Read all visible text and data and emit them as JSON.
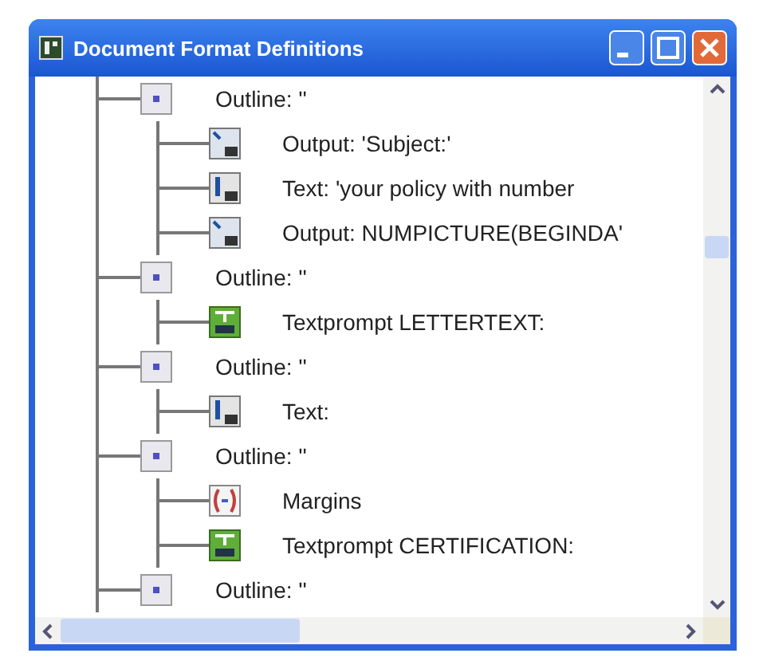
{
  "window": {
    "title": "Document Format Definitions"
  },
  "tree": [
    {
      "kind": "outline",
      "label": "Outline: ''",
      "children": [
        {
          "kind": "output",
          "label": "Output:  'Subject:'"
        },
        {
          "kind": "text",
          "label": "Text:  'your policy with number"
        },
        {
          "kind": "output",
          "label": "Output: NUMPICTURE(BEGINDA'"
        }
      ]
    },
    {
      "kind": "outline",
      "label": "Outline: ''",
      "children": [
        {
          "kind": "textprompt",
          "label": "Textprompt LETTERTEXT:"
        }
      ]
    },
    {
      "kind": "outline",
      "label": "Outline: ''",
      "children": [
        {
          "kind": "text",
          "label": "Text:"
        }
      ]
    },
    {
      "kind": "outline",
      "label": "Outline: ''",
      "children": [
        {
          "kind": "margins",
          "label": "Margins"
        },
        {
          "kind": "textprompt",
          "label": "Textprompt CERTIFICATION:"
        }
      ]
    },
    {
      "kind": "outline",
      "label": "Outline: ''"
    }
  ]
}
